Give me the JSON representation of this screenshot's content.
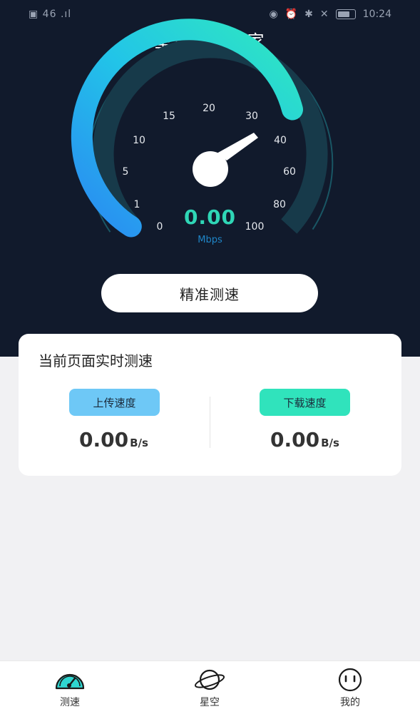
{
  "status_bar": {
    "left": "▣ 46 .ıl",
    "right_icons": [
      "eye-icon",
      "alarm-icon",
      "bluetooth-icon",
      "mute-icon"
    ],
    "time": "10:24"
  },
  "header": {
    "title": "星空测速管家"
  },
  "gauge": {
    "ticks": [
      "0",
      "1",
      "5",
      "10",
      "15",
      "20",
      "30",
      "40",
      "60",
      "80",
      "100"
    ],
    "value": "0.00",
    "unit": "Mbps",
    "colors": {
      "track": "#173a4a",
      "gradient_start": "#2a8bf2",
      "gradient_mid": "#22c4e8",
      "gradient_end": "#2fe8c0",
      "needle": "#ffffff"
    }
  },
  "actions": {
    "precise_test": "精准测速"
  },
  "realtime_card": {
    "title": "当前页面实时测速",
    "upload": {
      "label": "上传速度",
      "value": "0.00",
      "unit": "B/s"
    },
    "download": {
      "label": "下载速度",
      "value": "0.00",
      "unit": "B/s"
    }
  },
  "bottom_nav": {
    "items": [
      {
        "label": "测速",
        "icon": "speedometer-icon"
      },
      {
        "label": "星空",
        "icon": "planet-icon"
      },
      {
        "label": "我的",
        "icon": "smiley-icon"
      }
    ]
  },
  "colors": {
    "header_bg": "#111a2c",
    "accent_teal": "#2fd6b6",
    "upload_badge": "#6ec8f6",
    "download_badge": "#30e3bc",
    "page_bg": "#f1f1f3"
  }
}
